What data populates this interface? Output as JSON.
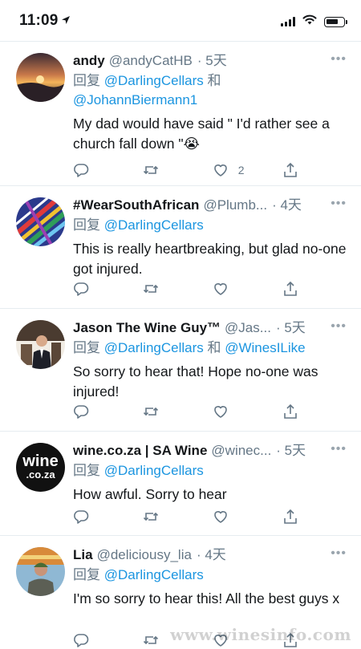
{
  "status": {
    "time": "11:09",
    "battery_level": 0.75
  },
  "tweets": [
    {
      "name": "andy",
      "handle": "@andyCatHB",
      "time": "· 5天",
      "reply_prefix": "回复",
      "reply_to": [
        "@DarlingCellars",
        "@JohannBiermann1"
      ],
      "reply_joiner": "和",
      "text": "My dad would have said \" I'd rather see a church fall down \"😭",
      "like_count": "2"
    },
    {
      "name": "#WearSouthAfrican",
      "handle": "@Plumb...",
      "time": "· 4天",
      "reply_prefix": "回复",
      "reply_to": [
        "@DarlingCellars"
      ],
      "text": "This is really heartbreaking, but glad no-one got injured.",
      "like_count": ""
    },
    {
      "name": "Jason The Wine Guy™",
      "handle": "@Jas...",
      "time": "· 5天",
      "reply_prefix": "回复",
      "reply_to": [
        "@DarlingCellars",
        "@WinesILike"
      ],
      "reply_joiner": "和",
      "text": "So sorry to hear that! Hope no-one was injured!",
      "like_count": ""
    },
    {
      "name": "wine.co.za | SA Wine",
      "handle": "@winec...",
      "time": "· 5天",
      "reply_prefix": "回复",
      "reply_to": [
        "@DarlingCellars"
      ],
      "text": "How awful. Sorry to hear",
      "like_count": "",
      "avatar_text_1": "wine",
      "avatar_text_2": ".co.za"
    },
    {
      "name": "Lia",
      "handle": "@deliciousy_lia",
      "time": "· 4天",
      "reply_prefix": "回复",
      "reply_to": [
        "@DarlingCellars"
      ],
      "text": "I'm so sorry to hear this! All the best guys x",
      "like_count": ""
    }
  ],
  "more_glyph": "•••",
  "watermark": "www.winesinfo.com",
  "colors": {
    "link": "#1b95e0",
    "secondary": "#657786",
    "divider": "#e6ecf0"
  }
}
